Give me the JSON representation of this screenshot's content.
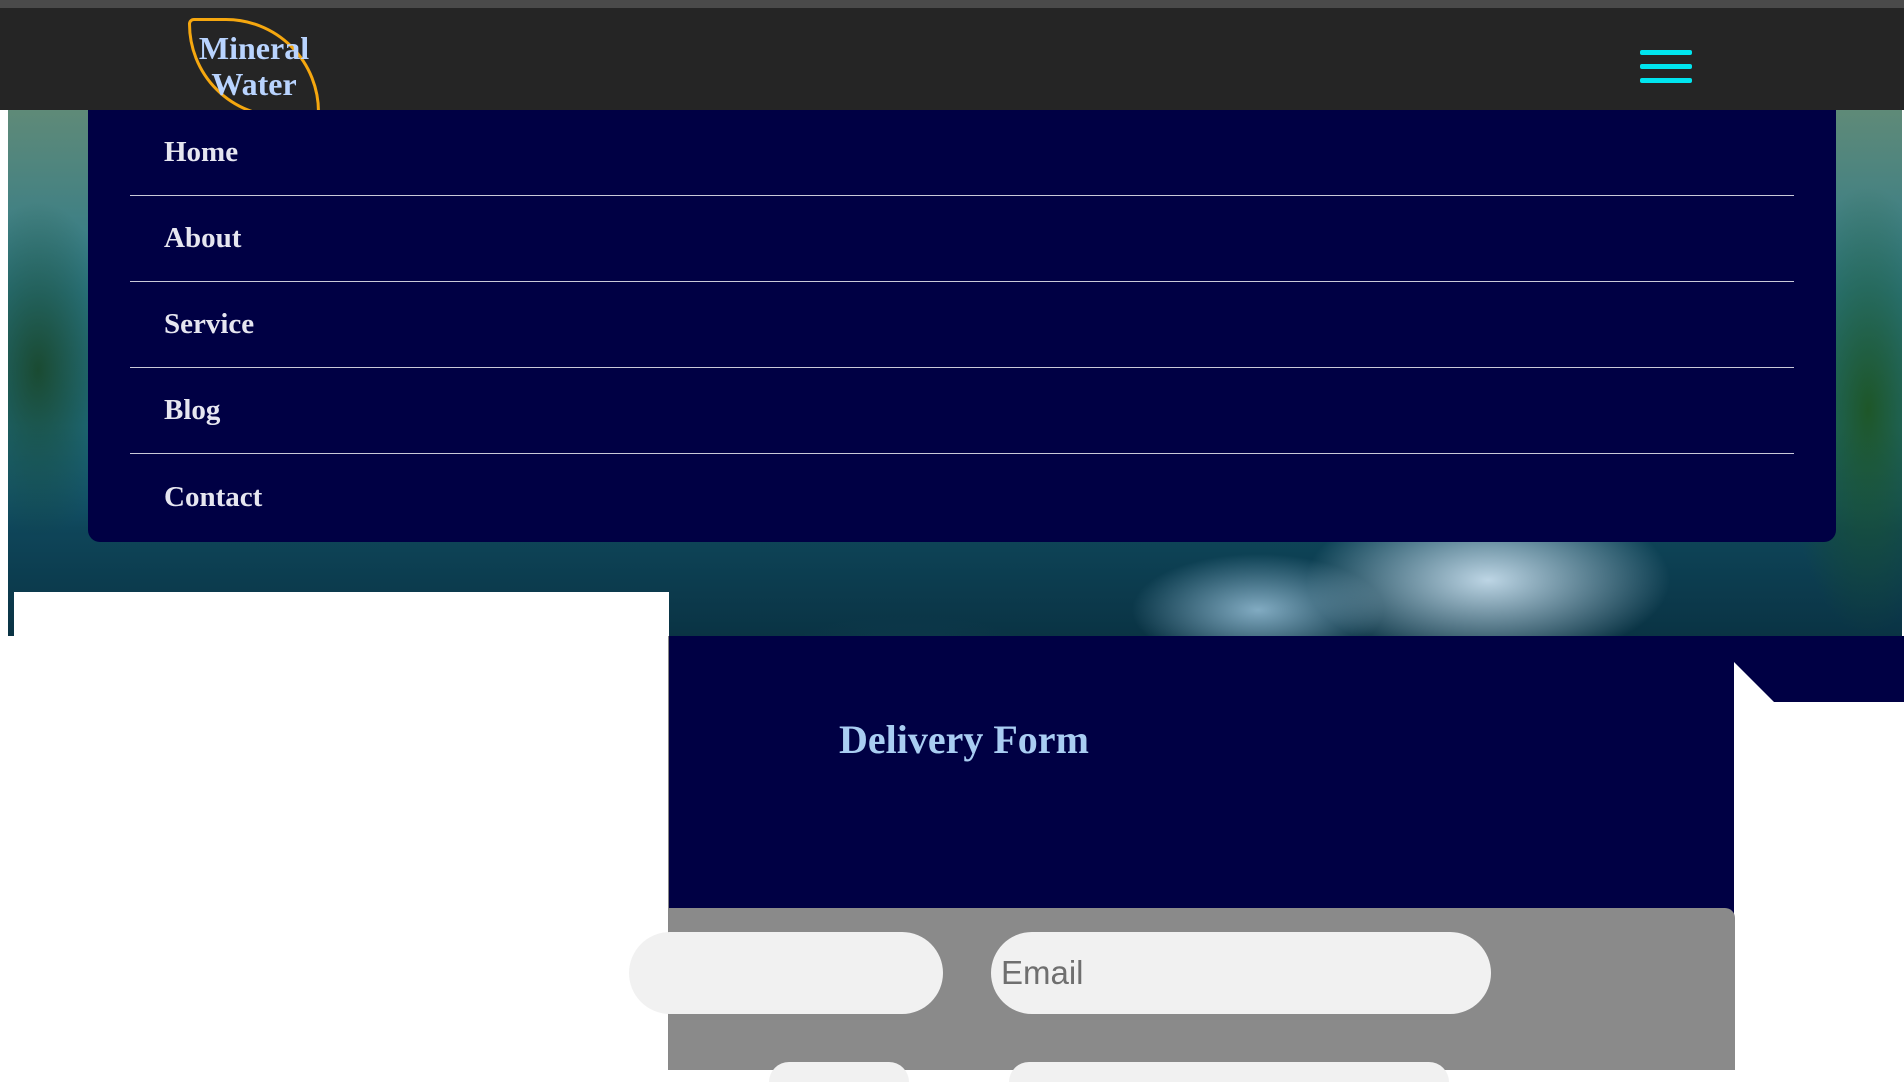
{
  "header": {
    "logo_line1": "Mineral",
    "logo_line2": "Water",
    "menu_icon": "hamburger-icon"
  },
  "nav": {
    "items": [
      {
        "label": "Home"
      },
      {
        "label": "About"
      },
      {
        "label": "Service"
      },
      {
        "label": "Blog"
      },
      {
        "label": "Contact"
      }
    ]
  },
  "delivery_form": {
    "title": "Delivery Form",
    "name_placeholder": "",
    "email_placeholder": "Email"
  },
  "colors": {
    "header_bg": "#252525",
    "nav_bg": "#000044",
    "logo_border": "#f5a70f",
    "menu_icon": "#00e5ef",
    "form_title": "#a9cdf2"
  }
}
